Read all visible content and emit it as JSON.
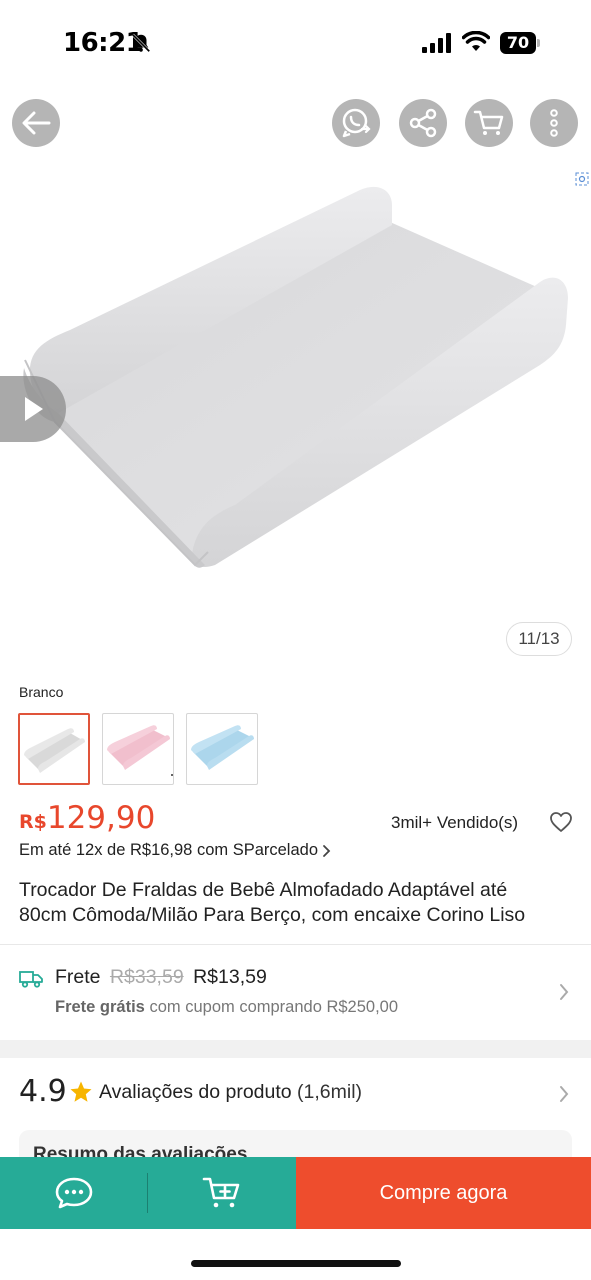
{
  "status_bar": {
    "time": "16:21",
    "battery": "70"
  },
  "icons": {
    "back": "arrow-left-icon",
    "whatsapp": "whatsapp-share-icon",
    "share": "share-icon",
    "cart": "cart-icon",
    "more": "more-vertical-icon",
    "zoom": "expand-icon",
    "play": "play-icon",
    "favorite": "heart-icon",
    "shipping": "truck-icon",
    "rating_star": "star-icon",
    "chat": "chat-icon",
    "add_to_cart": "cart-plus-icon"
  },
  "gallery": {
    "counter": "11/13"
  },
  "variant": {
    "label": "Branco",
    "options": [
      {
        "name": "Branco",
        "color": "#dcdcdc",
        "selected": true
      },
      {
        "name": "Rosa",
        "color": "#f2c6d2",
        "selected": false
      },
      {
        "name": "Azul",
        "color": "#b9def0",
        "selected": false
      }
    ]
  },
  "price": {
    "currency": "R$",
    "value": "129,90"
  },
  "sold": "3mil+ Vendido(s)",
  "installments": "Em até 12x de R$16,98 com SParcelado",
  "title": {
    "line1": "Trocador De Fraldas de Bebê Almofadado Adaptável até",
    "line2": "80cm Cômoda/Milão Para Berço, com encaixe Corino Liso"
  },
  "shipping": {
    "label": "Frete",
    "old_price": "R$33,59",
    "price": "R$13,59",
    "free_label": "Frete grátis",
    "free_condition": "com cupom comprando R$250,00"
  },
  "reviews": {
    "rating": "4.9",
    "label": "Avaliações do produto",
    "count": "(1,6mil)",
    "summary": "Resumo das avaliações"
  },
  "bottom_bar": {
    "buy_now": "Compre agora"
  },
  "colors": {
    "accent": "#ee4d2d",
    "price": "#e8472c",
    "teal": "#26ab97"
  }
}
